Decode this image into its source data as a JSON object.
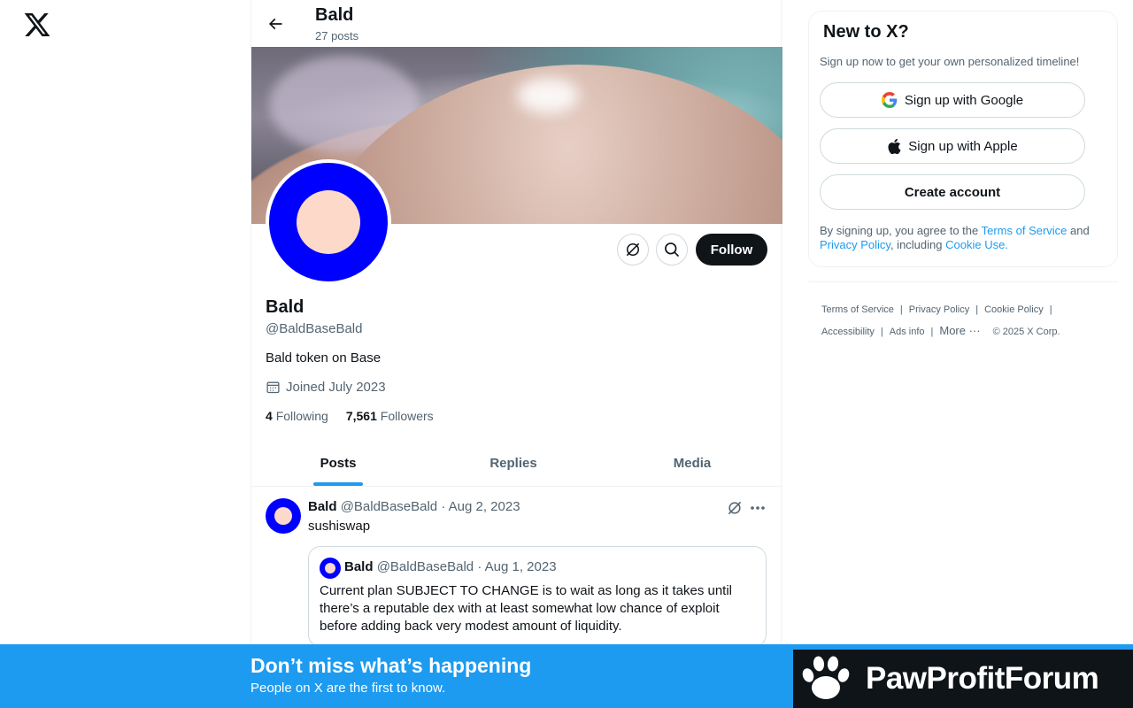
{
  "header": {
    "name": "Bald",
    "posts_count": "27 posts"
  },
  "profile": {
    "name": "Bald",
    "handle": "@BaldBaseBald",
    "bio": "Bald token on Base",
    "joined": "Joined July 2023",
    "following_count": "4",
    "following_label": "Following",
    "followers_count": "7,561",
    "followers_label": "Followers",
    "follow_label": "Follow",
    "avatar_colors": {
      "ring": "#0000ff",
      "center": "#fcd9c8"
    }
  },
  "tabs": [
    {
      "label": "Posts",
      "active": true
    },
    {
      "label": "Replies",
      "active": false
    },
    {
      "label": "Media",
      "active": false
    }
  ],
  "post": {
    "name": "Bald",
    "meta": "@BaldBaseBald · Aug 2, 2023",
    "text": "sushiswap",
    "quote": {
      "name": "Bald",
      "meta": "@BaldBaseBald · Aug 1, 2023",
      "text": "Current plan SUBJECT TO CHANGE is to wait as long as it takes until there’s a reputable dex with at least somewhat low chance of exploit before adding back very modest amount of liquidity."
    }
  },
  "signup": {
    "title": "New to X?",
    "subtitle": "Sign up now to get your own personalized timeline!",
    "google_label": "Sign up with Google",
    "apple_label": "Sign up with Apple",
    "create_label": "Create account",
    "legal_prefix": "By signing up, you agree to the ",
    "terms_link": "Terms of Service",
    "legal_and": " and ",
    "privacy_link": "Privacy Policy",
    "legal_including": ", including ",
    "cookie_link": "Cookie Use."
  },
  "footer": {
    "terms": "Terms of Service",
    "privacy": "Privacy Policy",
    "cookie": "Cookie Policy",
    "accessibility": "Accessibility",
    "ads": "Ads info",
    "more": "More ···",
    "copyright": "© 2025 X Corp."
  },
  "bottom_bar": {
    "title": "Don’t miss what’s happening",
    "subtitle": "People on X are the first to know."
  },
  "watermark": {
    "text": "PawProfitForum"
  },
  "colors": {
    "accent": "#1d9bf0",
    "text": "#0f1419",
    "muted": "#536471"
  }
}
